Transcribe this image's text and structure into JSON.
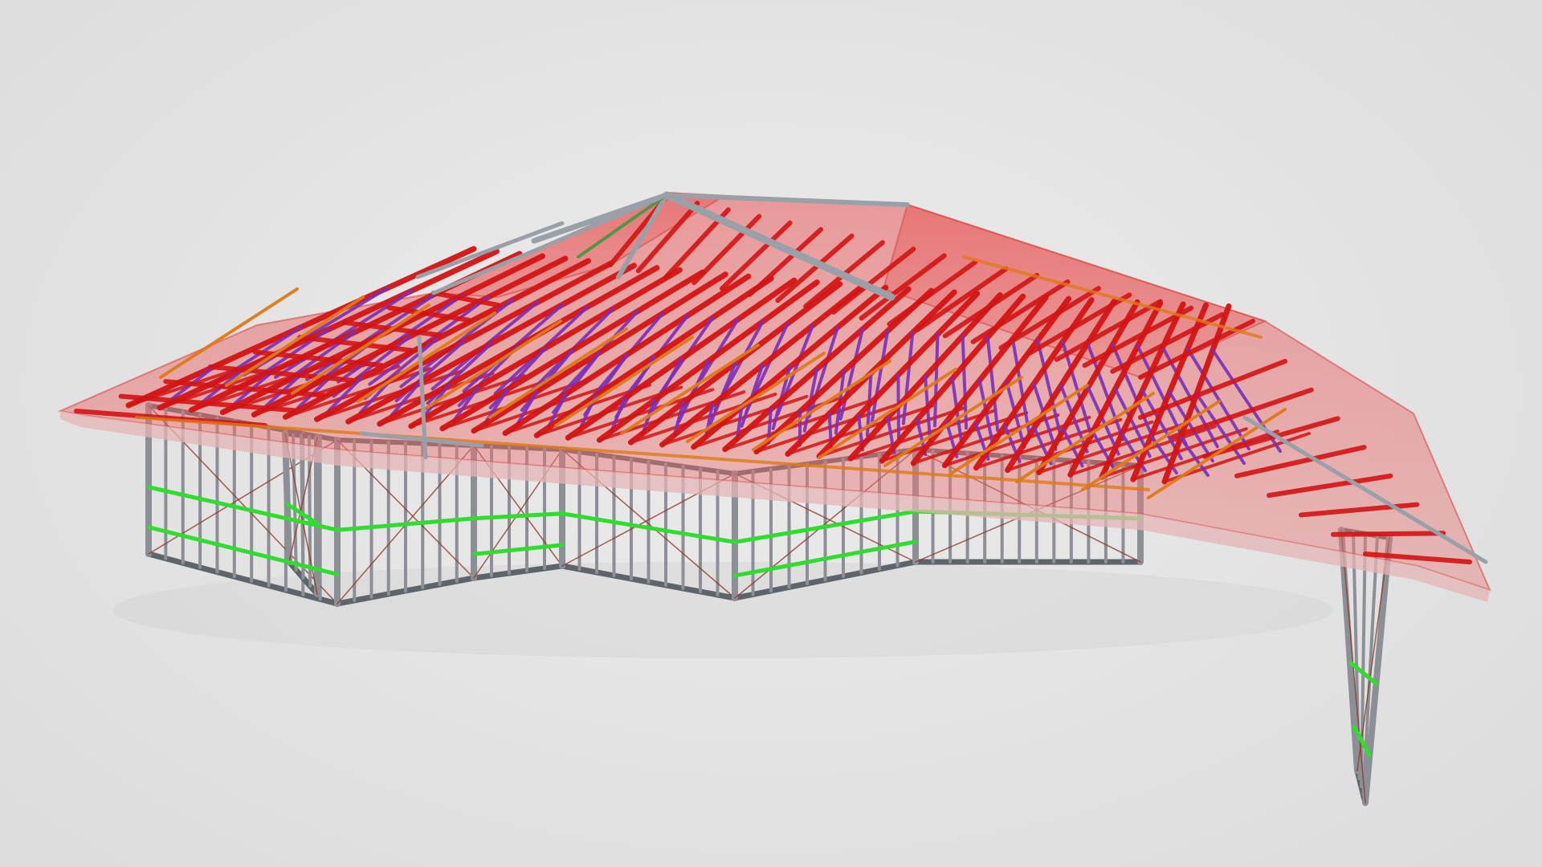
{
  "scene": {
    "background": "#e3e3e3",
    "model": "steel-frame-house",
    "colors": {
      "wall_frame": "#8c9096",
      "wall_frame_dark": "#5f646b",
      "nogging": "#2fdc2f",
      "truss_chord": "#d41414",
      "truss_web": "#7a2fb8",
      "roof_batten": "#e07a18",
      "ridge": "#9aa0a8",
      "roof_sheet": "#d84a4a",
      "eave_fascia": "#e6b4b4"
    },
    "materials": [
      "wall-studs",
      "wall-noggings",
      "roof-trusses",
      "truss-webs",
      "roof-battens",
      "ridge-beam",
      "translucent-roof-sheet"
    ]
  }
}
